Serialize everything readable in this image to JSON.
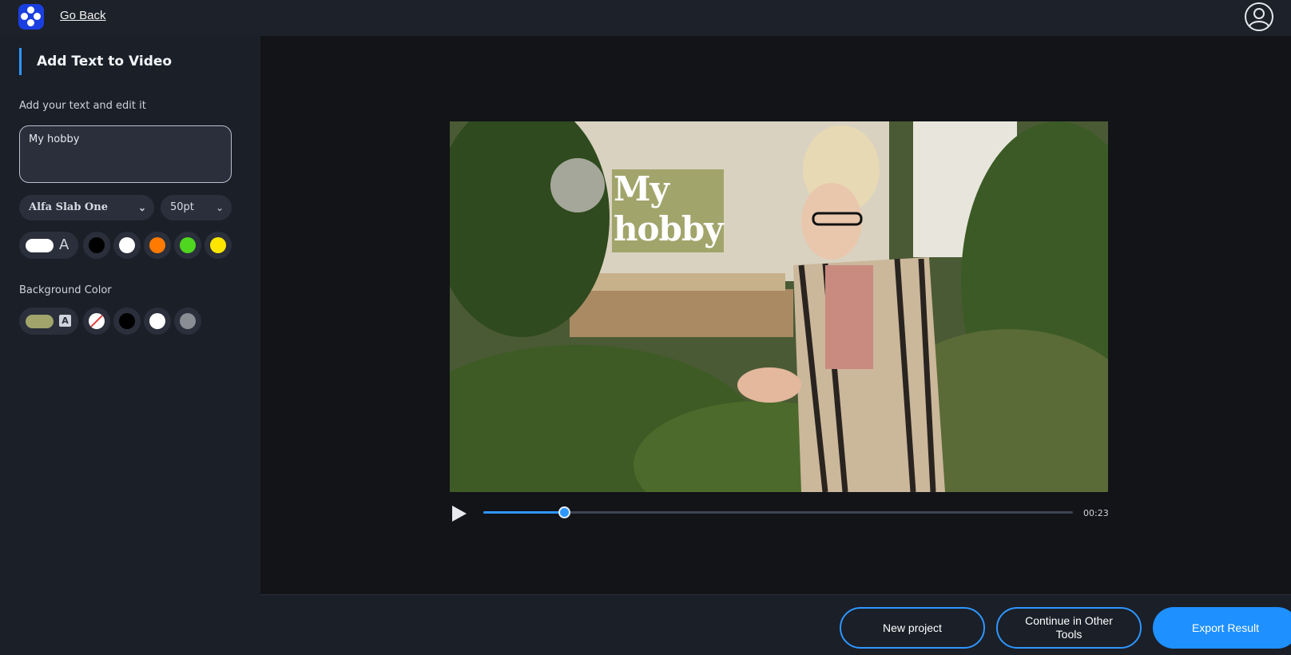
{
  "header": {
    "back_label": "Go Back"
  },
  "sidebar": {
    "title": "Add Text to Video",
    "text_label": "Add your text and edit it",
    "text_value": "My hobby",
    "font": "Alfa Slab One",
    "font_size": "50pt",
    "text_color": {
      "selected": "#ffffff",
      "glyph": "A",
      "swatches": [
        "#000000",
        "#ffffff",
        "#ff7a00",
        "#4fd61f",
        "#ffe600"
      ]
    },
    "background_label": "Background Color",
    "background_color": {
      "selected": "#a1a56b",
      "glyph": "A",
      "swatches": [
        "none",
        "#000000",
        "#ffffff",
        "#8a8d93"
      ]
    }
  },
  "video": {
    "overlay_text_line1": "My",
    "overlay_text_line2": "hobby",
    "progress_fraction": 0.137,
    "duration": "00:23"
  },
  "footer": {
    "new_project_label": "New project",
    "continue_label": "Continue in Other Tools",
    "export_label": "Export Result"
  },
  "colors": {
    "accent": "#2e97ff",
    "topbar": "#1d212a",
    "panel": "#1b1f28",
    "stage": "#121418"
  }
}
